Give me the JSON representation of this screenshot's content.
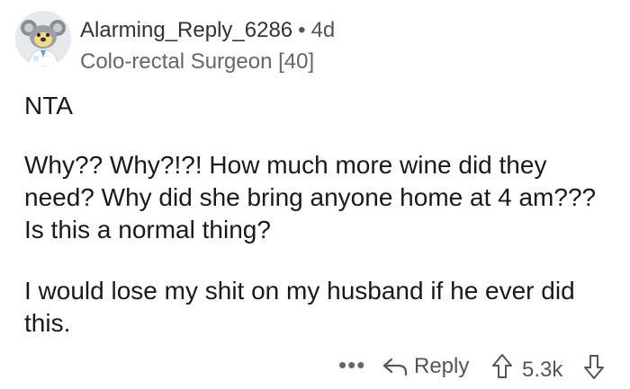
{
  "comment": {
    "author": {
      "username": "Alarming_Reply_6286",
      "separator": "•",
      "age": "4d",
      "flair": "Colo-rectal Surgeon [40]",
      "avatar_icon": "koala-avatar-icon"
    },
    "paragraphs": [
      "NTA",
      "Why?? Why?!?! How much more wine did they need? Why did she bring anyone home at 4 am??? Is this a normal thing?",
      "I would lose my shit on my husband if he ever did this."
    ],
    "actions": {
      "more_label": "•••",
      "reply_label": "Reply",
      "vote_count": "5.3k"
    }
  },
  "colors": {
    "background": "#ffffff",
    "text": "#1a1a1b",
    "meta": "#555555"
  }
}
